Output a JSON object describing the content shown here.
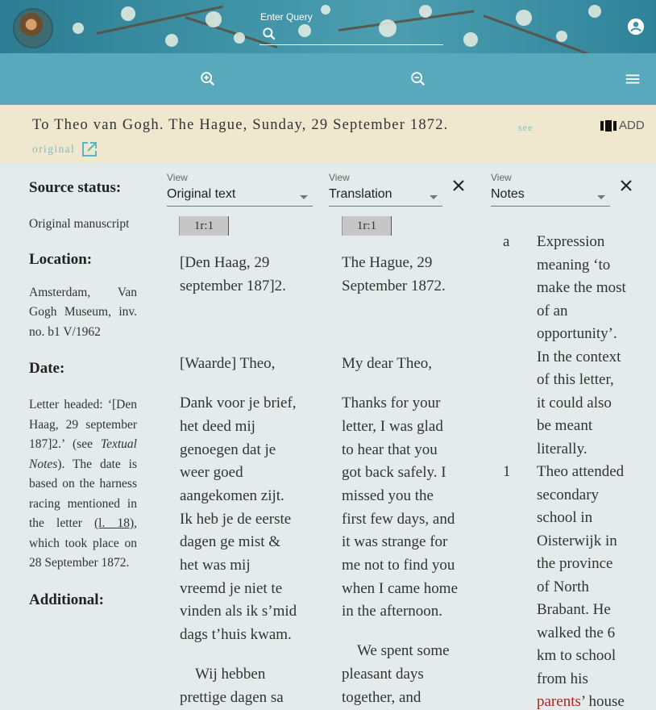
{
  "header": {
    "search_placeholder": "Enter Query"
  },
  "letter": {
    "title": "To Theo van Gogh. The Hague, Sunday, 29 September 1872.",
    "see_label": "see",
    "add_label": "ADD",
    "original_label": "original"
  },
  "sidebar": {
    "source_status_heading": "Source status:",
    "source_status_value": "Original manuscript",
    "location_heading": "Location:",
    "location_value": "Amsterdam, Van Gogh Museum, inv. no. b1 V/1962",
    "date_heading": "Date:",
    "date_p1": "Letter headed: ‘[Den Haag, 29 september 187]2.’ (see ",
    "date_p1_em": "Textual Notes",
    "date_p2": "). The date is based on the harness racing mentioned in the letter ",
    "date_link": "(l. 18)",
    "date_p3": ", which took place on 28 September 1872.",
    "additional_heading": "Additional:"
  },
  "panels": [
    {
      "view_label": "View",
      "selected": "Original text",
      "page": "1r:1"
    },
    {
      "view_label": "View",
      "selected": "Translation",
      "page": "1r:1"
    },
    {
      "view_label": "View",
      "selected": "Notes"
    }
  ],
  "original": {
    "heading_l1": "[Den Haag, 29",
    "heading_l2": "september 187]2.",
    "salutation": "[Waarde] Theo,",
    "p1": [
      "Dank voor je brief,",
      "het deed mij",
      "genoegen dat je",
      "weer goed",
      "aangekomen zijt.",
      "Ik heb je de eerste",
      "dagen ge mist &",
      "het was mij",
      "vreemd je niet te",
      "vinden als ik s’mid",
      "dags t’huis kwam."
    ],
    "p2": [
      "Wij hebben",
      "prettige dagen sa"
    ]
  },
  "translation": {
    "heading_l1": "The Hague, 29",
    "heading_l2": "September 1872.",
    "salutation": "My dear Theo,",
    "p1": [
      "Thanks for your",
      "letter, I was glad",
      "to hear that you",
      "got back safely. I",
      "missed you the",
      "first few days, and",
      "it was strange for",
      "me not to find you",
      "when I came home",
      "in the afternoon."
    ],
    "p2": [
      "We spent some",
      "pleasant days",
      "together, and"
    ]
  },
  "notes": [
    {
      "marker": "a",
      "lines": [
        "Expression",
        "meaning ‘to",
        "make the most",
        "of an",
        "opportunity’.",
        "In the context",
        "of this letter,",
        "it could also",
        "be meant",
        "literally."
      ]
    },
    {
      "marker": "1",
      "lines": [
        "Theo attended",
        "secondary",
        "school in",
        "Oisterwijk in",
        "the province",
        "of North",
        "Brabant. He",
        "walked the 6",
        "km to school",
        "from his"
      ],
      "link_word": "parents",
      "tail": "’ house"
    }
  ]
}
